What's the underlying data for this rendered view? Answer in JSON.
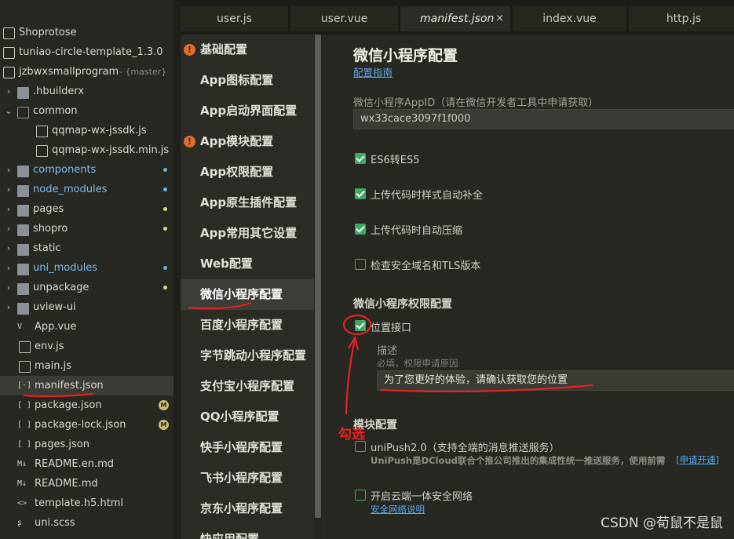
{
  "tree": [
    {
      "label": "Shoprotose",
      "kind": "project"
    },
    {
      "label": "tuniao-circle-template_1.3.0",
      "kind": "project"
    },
    {
      "label": "jzbwxsmallprogram",
      "kind": "project",
      "branch": "- {master}"
    },
    {
      "label": ".hbuilderx",
      "kind": "folder"
    },
    {
      "label": "common",
      "kind": "folder-open"
    },
    {
      "label": "qqmap-wx-jssdk.js",
      "kind": "file"
    },
    {
      "label": "qqmap-wx-jssdk.min.js",
      "kind": "file"
    },
    {
      "label": "components",
      "kind": "folder",
      "blue": true,
      "dot": "#6fb3ee"
    },
    {
      "label": "node_modules",
      "kind": "folder",
      "blue": true,
      "dot": "#6fb3ee"
    },
    {
      "label": "pages",
      "kind": "folder",
      "dot": "#e0d58a"
    },
    {
      "label": "shopro",
      "kind": "folder",
      "dot": "#e0d58a"
    },
    {
      "label": "static",
      "kind": "folder"
    },
    {
      "label": "uni_modules",
      "kind": "folder",
      "blue": true,
      "dot": "#6fb3ee"
    },
    {
      "label": "unpackage",
      "kind": "folder",
      "dot": "#e0d58a"
    },
    {
      "label": "uview-ui",
      "kind": "folder"
    },
    {
      "label": "App.vue",
      "kind": "file",
      "glyph": "V"
    },
    {
      "label": "env.js",
      "kind": "file"
    },
    {
      "label": "main.js",
      "kind": "file"
    },
    {
      "label": "manifest.json",
      "kind": "file",
      "glyph": "[·]",
      "selected": true
    },
    {
      "label": "package.json",
      "kind": "file",
      "glyph": "[ ]",
      "badge": "M"
    },
    {
      "label": "package-lock.json",
      "kind": "file",
      "glyph": "[ ]",
      "badge": "M"
    },
    {
      "label": "pages.json",
      "kind": "file",
      "glyph": "[ ]"
    },
    {
      "label": "README.en.md",
      "kind": "file",
      "glyph": "M↓"
    },
    {
      "label": "README.md",
      "kind": "file",
      "glyph": "M↓"
    },
    {
      "label": "template.h5.html",
      "kind": "file",
      "glyph": "<>"
    },
    {
      "label": "uni.scss",
      "kind": "file",
      "glyph": "ʂ"
    }
  ],
  "tabs": [
    {
      "label": "user.js"
    },
    {
      "label": "user.vue"
    },
    {
      "label": "manifest.json",
      "active": true,
      "close": "×"
    },
    {
      "label": "index.vue"
    },
    {
      "label": "http.js"
    }
  ],
  "nav": [
    {
      "label": "基础配置",
      "warn": true
    },
    {
      "label": "App图标配置"
    },
    {
      "label": "App启动界面配置"
    },
    {
      "label": "App模块配置",
      "warn": true
    },
    {
      "label": "App权限配置"
    },
    {
      "label": "App原生插件配置"
    },
    {
      "label": "App常用其它设置"
    },
    {
      "label": "Web配置"
    },
    {
      "label": "微信小程序配置",
      "active": true
    },
    {
      "label": "百度小程序配置"
    },
    {
      "label": "字节跳动小程序配置"
    },
    {
      "label": "支付宝小程序配置"
    },
    {
      "label": "QQ小程序配置"
    },
    {
      "label": "快手小程序配置"
    },
    {
      "label": "飞书小程序配置"
    },
    {
      "label": "京东小程序配置"
    },
    {
      "label": "快应用配置"
    }
  ],
  "warn_glyph": "!",
  "content": {
    "title": "微信小程序配置",
    "guide_link": "配置指南",
    "appid_label": "微信小程序AppID（请在微信开发者工具中申请获取）",
    "appid_value": "wx33cace3097f1f000",
    "options": [
      {
        "label": "ES6转ES5",
        "checked": true
      },
      {
        "label": "上传代码时样式自动补全",
        "checked": true
      },
      {
        "label": "上传代码时自动压缩",
        "checked": true
      },
      {
        "label": "检查安全域名和TLS版本",
        "checked": false
      }
    ],
    "perm_title": "微信小程序权限配置",
    "location_label": "位置接口",
    "location_checked": true,
    "desc_label": "描述",
    "desc_hint": "必填，权限申请原因",
    "desc_value": "为了您更好的体验，请确认获取您的位置",
    "module_title": "模块配置",
    "unipush_label": "uniPush2.0（支持全端的消息推送服务）",
    "unipush_desc": "UniPush是DCloud联合个推公司推出的集成性统一推送服务，使用前需",
    "unipush_link": "[申请开通]",
    "cloud_label": "开启云端一体安全网络",
    "cloud_link": "安全网络说明"
  },
  "annotation": {
    "text": "勾选",
    "color": "#e52222"
  },
  "watermark": "CSDN @荀鼠不是鼠"
}
